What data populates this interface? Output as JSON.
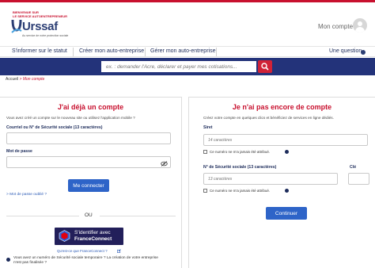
{
  "header": {
    "tagline_1": "BIENVENUE SUR",
    "tagline_2": "LE SERVICE AUTOENTREPRENEUR",
    "logo_text": "Urssaf",
    "logo_sub": "Au service de notre protection sociale",
    "account_label": "Mon compte",
    "colors": {
      "brand_red": "#c8102e",
      "brand_blue": "#23337a"
    }
  },
  "nav": {
    "items": [
      {
        "label": "S'informer sur le statut"
      },
      {
        "label": "Créer mon auto-entreprise"
      },
      {
        "label": "Gérer mon auto-entreprise"
      }
    ],
    "question_label": "Une question"
  },
  "search": {
    "placeholder": "ex. : demander l'Acre, déclarer et payer mes cotisations...",
    "icon": "search-icon"
  },
  "breadcrumb": {
    "home": "Accueil",
    "current": "> Mon compte"
  },
  "login": {
    "title": "J'ai déjà un compte",
    "desc": "Vous avez créé un compte sur le nouveau site ou utilisez l'application mobile ?",
    "ssn_label": "Courriel ou N° de Sécurité sociale (13 caractères)",
    "ssn_value": "",
    "password_label": "Mot de passe",
    "password_value": "",
    "submit_label": "Me connecter",
    "forgot_label": "> Mot de passe oublié ?",
    "or_label": "OU",
    "franceconnect_line1": "S'identifier avec",
    "franceconnect_line2": "FranceConnect",
    "franceconnect_link": "Qu'est-ce que FranceConnect ?",
    "temp_ssn_line1": "Vous avez un numéro de Sécurité sociale temporaire ? La création de votre entreprise",
    "temp_ssn_line2": "n'est pas finalisée ?"
  },
  "signup": {
    "title": "Je n'ai pas encore de compte",
    "desc_line1": "Créez votre compte en quelques clics et bénéficiez de services en ligne dédiés.",
    "siret_label": "Siret",
    "siret_placeholder": "14 caractères",
    "siret_checkbox": "Ce numéro ne m'a jamais été attribué.",
    "ssn_label": "N° de Sécurité sociale (13 caractères)",
    "ssn_placeholder": "13 caractères",
    "key_label": "Clé",
    "ssn_checkbox": "Ce numéro ne m'a jamais été attribué.",
    "continue_label": "Continuer"
  }
}
